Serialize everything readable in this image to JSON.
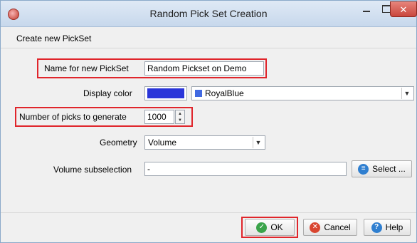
{
  "window": {
    "title": "Random Pick Set Creation",
    "close_glyph": "✕"
  },
  "header": {
    "label": "Create new PickSet"
  },
  "form": {
    "name_label": "Name for new PickSet",
    "name_value": "Random Pickset on Demo",
    "color_label": "Display color",
    "color_hex": "#2a35d9",
    "color_name": "RoyalBlue",
    "color_name_swatch_hex": "#4169e1",
    "picks_label": "Number of picks to generate",
    "picks_value": "1000",
    "geometry_label": "Geometry",
    "geometry_value": "Volume",
    "volume_label": "Volume subselection",
    "volume_value": "-",
    "select_label": "Select ..."
  },
  "footer": {
    "ok_label": "OK",
    "cancel_label": "Cancel",
    "help_label": "Help"
  },
  "icons": {
    "select": "list-icon",
    "ok": "check-icon",
    "cancel": "cancel-x-icon",
    "help": "help-question-icon"
  },
  "colors": {
    "highlight": "#e0252b",
    "ok_icon": "#3aa34a",
    "cancel_icon": "#d9452f",
    "help_icon": "#2f7fd0",
    "select_icon": "#2f7fd0"
  }
}
